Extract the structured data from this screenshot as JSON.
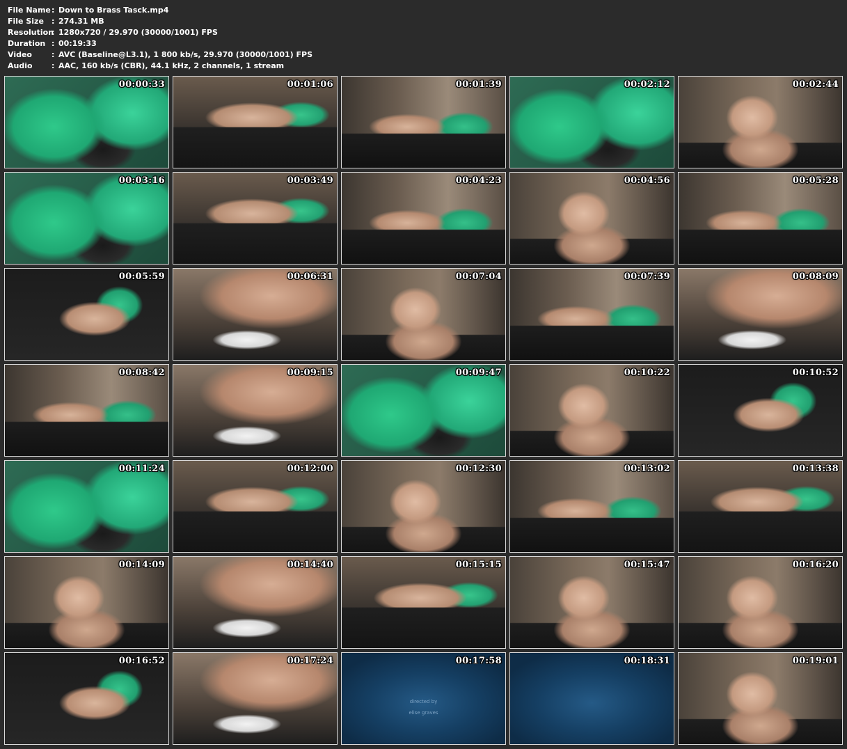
{
  "info": [
    {
      "key": "File Name",
      "value": "Down to Brass Tasck.mp4"
    },
    {
      "key": "File Size",
      "value": "274.31 MB"
    },
    {
      "key": "Resolution",
      "value": "1280x720 / 29.970 (30000/1001) FPS"
    },
    {
      "key": "Duration",
      "value": "00:19:33"
    },
    {
      "key": "Video",
      "value": "AVC (Baseline@L3.1), 1 800 kb/s, 29.970 (30000/1001) FPS"
    },
    {
      "key": "Audio",
      "value": "AAC, 160 kb/s (CBR), 44.1 kHz, 2 channels, 1 stream"
    }
  ],
  "credit": {
    "line1": "directed by",
    "line2": "elise graves"
  },
  "thumbnails": [
    {
      "time": "00:00:33",
      "scene": "green-closeup"
    },
    {
      "time": "00:01:06",
      "scene": "table-room"
    },
    {
      "time": "00:01:39",
      "scene": "room-wide"
    },
    {
      "time": "00:02:12",
      "scene": "green-closeup"
    },
    {
      "time": "00:02:44",
      "scene": "face-room"
    },
    {
      "time": "00:03:16",
      "scene": "green-closeup"
    },
    {
      "time": "00:03:49",
      "scene": "table-room"
    },
    {
      "time": "00:04:23",
      "scene": "room-wide"
    },
    {
      "time": "00:04:56",
      "scene": "face-room"
    },
    {
      "time": "00:05:28",
      "scene": "room-wide"
    },
    {
      "time": "00:05:59",
      "scene": "floor-top"
    },
    {
      "time": "00:06:31",
      "scene": "skin-closeup"
    },
    {
      "time": "00:07:04",
      "scene": "face-room"
    },
    {
      "time": "00:07:39",
      "scene": "room-wide"
    },
    {
      "time": "00:08:09",
      "scene": "skin-closeup"
    },
    {
      "time": "00:08:42",
      "scene": "room-wide"
    },
    {
      "time": "00:09:15",
      "scene": "skin-closeup"
    },
    {
      "time": "00:09:47",
      "scene": "green-closeup"
    },
    {
      "time": "00:10:22",
      "scene": "face-room"
    },
    {
      "time": "00:10:52",
      "scene": "floor-top"
    },
    {
      "time": "00:11:24",
      "scene": "green-closeup"
    },
    {
      "time": "00:12:00",
      "scene": "table-room"
    },
    {
      "time": "00:12:30",
      "scene": "face-room"
    },
    {
      "time": "00:13:02",
      "scene": "room-wide"
    },
    {
      "time": "00:13:38",
      "scene": "table-room"
    },
    {
      "time": "00:14:09",
      "scene": "face-room"
    },
    {
      "time": "00:14:40",
      "scene": "skin-closeup"
    },
    {
      "time": "00:15:15",
      "scene": "table-room"
    },
    {
      "time": "00:15:47",
      "scene": "face-room"
    },
    {
      "time": "00:16:20",
      "scene": "face-room"
    },
    {
      "time": "00:16:52",
      "scene": "floor-top"
    },
    {
      "time": "00:17:24",
      "scene": "skin-closeup"
    },
    {
      "time": "00:17:58",
      "scene": "credits",
      "credit": true
    },
    {
      "time": "00:18:31",
      "scene": "credits"
    },
    {
      "time": "00:19:01",
      "scene": "face-room"
    }
  ]
}
